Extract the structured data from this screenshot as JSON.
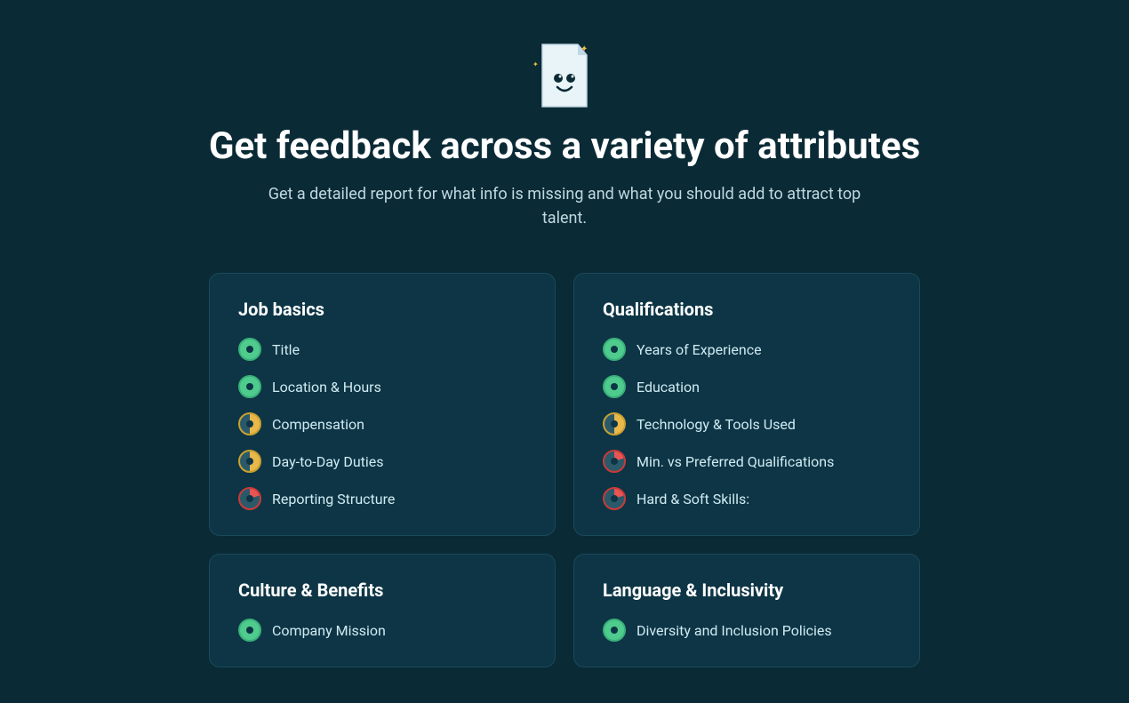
{
  "header": {
    "title": "Get feedback across a variety of attributes",
    "subtitle": "Get a detailed report for what info is missing and what you should add to attract top talent."
  },
  "cards": [
    {
      "id": "job-basics",
      "title": "Job basics",
      "items": [
        {
          "label": "Title",
          "status": "full"
        },
        {
          "label": "Location & Hours",
          "status": "full"
        },
        {
          "label": "Compensation",
          "status": "half"
        },
        {
          "label": "Day-to-Day Duties",
          "status": "half"
        },
        {
          "label": "Reporting Structure",
          "status": "low"
        }
      ]
    },
    {
      "id": "qualifications",
      "title": "Qualifications",
      "items": [
        {
          "label": "Years of Experience",
          "status": "full"
        },
        {
          "label": "Education",
          "status": "full"
        },
        {
          "label": "Technology & Tools Used",
          "status": "half"
        },
        {
          "label": "Min. vs Preferred Qualifications",
          "status": "low"
        },
        {
          "label": "Hard & Soft Skills:",
          "status": "low"
        }
      ]
    },
    {
      "id": "culture-benefits",
      "title": "Culture & Benefits",
      "items": [
        {
          "label": "Company Mission",
          "status": "full"
        }
      ]
    },
    {
      "id": "language-inclusivity",
      "title": "Language & Inclusivity",
      "items": [
        {
          "label": "Diversity and Inclusion Policies",
          "status": "full"
        }
      ]
    }
  ]
}
